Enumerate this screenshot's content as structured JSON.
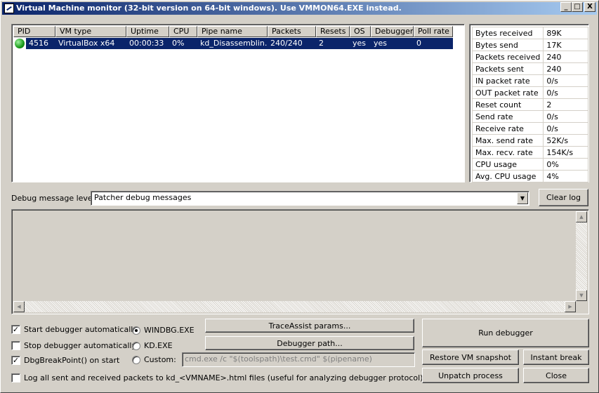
{
  "window": {
    "title": "Virtual Machine monitor (32-bit version on 64-bit windows). Use VMMON64.EXE instead.",
    "min_label": "_",
    "max_label": "□",
    "close_label": "X"
  },
  "vm_list": {
    "columns": [
      "PID",
      "VM type",
      "Uptime",
      "CPU",
      "Pipe name",
      "Packets",
      "Resets",
      "OS",
      "Debugger",
      "Poll rate"
    ],
    "rows": [
      {
        "status": "running",
        "pid": "4516",
        "vm_type": "VirtualBox x64",
        "uptime": "00:00:33",
        "cpu": "0%",
        "pipe_name": "kd_Disassemblin...",
        "packets": "240/240",
        "resets": "2",
        "os": "yes",
        "debugger": "yes",
        "poll_rate": "0"
      }
    ]
  },
  "stats": [
    {
      "key": "Bytes received",
      "value": "89K"
    },
    {
      "key": "Bytes send",
      "value": "17K"
    },
    {
      "key": "Packets received",
      "value": "240"
    },
    {
      "key": "Packets sent",
      "value": "240"
    },
    {
      "key": "IN packet rate",
      "value": "0/s"
    },
    {
      "key": "OUT packet rate",
      "value": "0/s"
    },
    {
      "key": "Reset count",
      "value": "2"
    },
    {
      "key": "Send rate",
      "value": "0/s"
    },
    {
      "key": "Receive rate",
      "value": "0/s"
    },
    {
      "key": "Max. send rate",
      "value": "52K/s"
    },
    {
      "key": "Max. recv. rate",
      "value": "154K/s"
    },
    {
      "key": "CPU usage",
      "value": "0%"
    },
    {
      "key": "Avg. CPU usage",
      "value": "4%"
    }
  ],
  "debug": {
    "level_label": "Debug message level:",
    "level_value": "Patcher debug messages",
    "clear_log": "Clear log"
  },
  "options": {
    "start_auto": {
      "label": "Start debugger automatically",
      "checked": true
    },
    "stop_auto": {
      "label": "Stop debugger automatically",
      "checked": false
    },
    "dbg_break": {
      "label": "DbgBreakPoint() on start",
      "checked": true
    },
    "log_packets": {
      "label": "Log all sent and received packets to kd_<VMNAME>.html files (useful for analyzing debugger protocol)",
      "checked": false
    }
  },
  "debugger_choice": {
    "windbg": "WINDBG.EXE",
    "kd": "KD.EXE",
    "custom": "Custom:",
    "selected": "windbg",
    "custom_value": "cmd.exe /c \"$(toolspath)\\test.cmd\" $(pipename)"
  },
  "buttons": {
    "traceassist": "TraceAssist params...",
    "debugger_path": "Debugger path...",
    "run_debugger": "Run debugger",
    "restore_snapshot": "Restore VM snapshot",
    "instant_break": "Instant break",
    "unpatch": "Unpatch process",
    "close": "Close"
  },
  "colors": {
    "selection": "#0a246a",
    "title_start": "#0a246a",
    "title_end": "#a6caf0",
    "face": "#d4d0c8"
  }
}
